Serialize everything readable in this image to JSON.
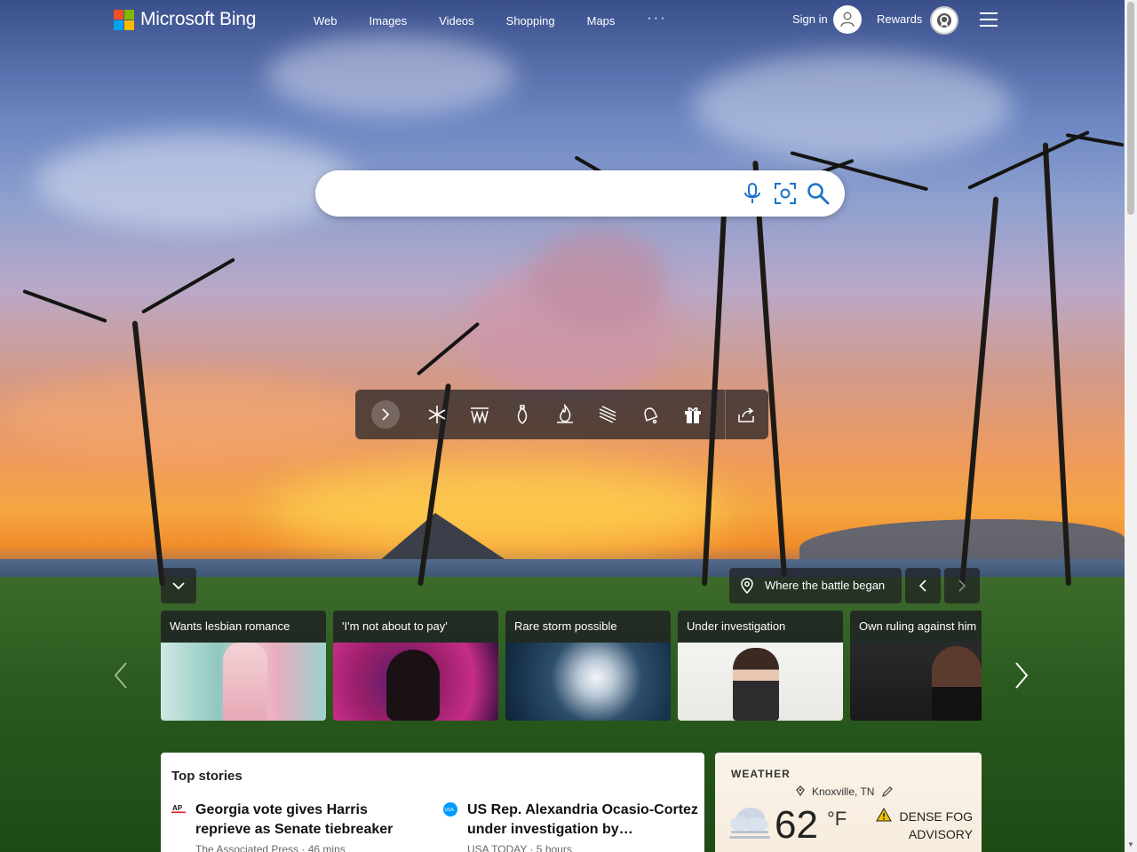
{
  "brand": {
    "logo_text": "Microsoft Bing",
    "colors": [
      "#f25022",
      "#7fba00",
      "#00a4ef",
      "#ffb900"
    ]
  },
  "nav": {
    "items": [
      {
        "label": "Web"
      },
      {
        "label": "Images"
      },
      {
        "label": "Videos"
      },
      {
        "label": "Shopping"
      },
      {
        "label": "Maps"
      }
    ],
    "more": "···"
  },
  "account": {
    "signin_label": "Sign in",
    "rewards_label": "Rewards"
  },
  "search": {
    "value": "",
    "icons": [
      "microphone-icon",
      "visual-search-icon",
      "search-icon"
    ],
    "accent": "#1a73c8"
  },
  "toolbar": {
    "icons": [
      "expand-arrow-icon",
      "snowflake-icon",
      "wave-icon",
      "ornament-icon",
      "fire-icon",
      "wind-icon",
      "bell-icon",
      "gift-icon",
      "share-icon"
    ]
  },
  "carousel": {
    "location_label": "Where the battle began",
    "cards": [
      {
        "title": "Wants lesbian romance"
      },
      {
        "title": "'I'm not about to pay'"
      },
      {
        "title": "Rare storm possible"
      },
      {
        "title": "Under investigation"
      },
      {
        "title": "Own ruling against him"
      }
    ]
  },
  "top_stories": {
    "title": "Top stories",
    "items": [
      {
        "source_badge": "AP",
        "headline": "Georgia vote gives Harris reprieve as Senate tiebreaker",
        "meta": "The Associated Press · 46 mins"
      },
      {
        "source_badge": "USA",
        "headline": "US Rep. Alexandria Ocasio-Cortez under investigation by…",
        "meta": "USA TODAY · 5 hours"
      }
    ]
  },
  "weather": {
    "title": "WEATHER",
    "location": "Knoxville, TN",
    "temperature": "62",
    "unit": "°F",
    "alert_line1": "DENSE FOG",
    "alert_line2": "ADVISORY"
  }
}
